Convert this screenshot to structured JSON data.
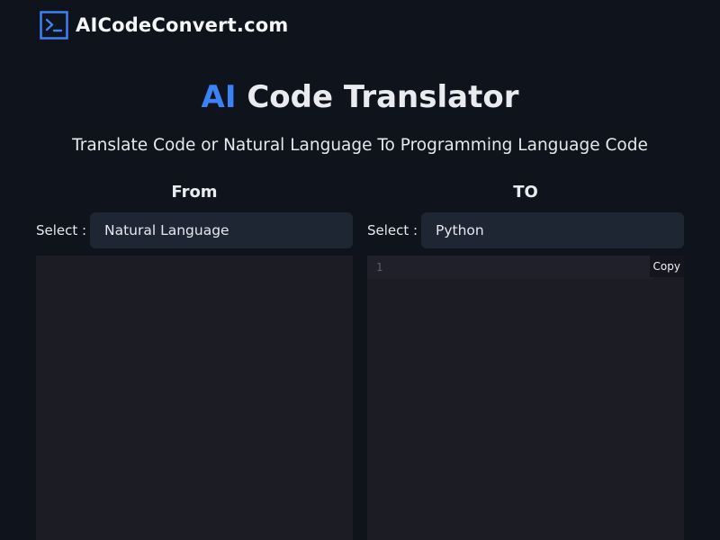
{
  "header": {
    "brand_text": "AICodeConvert.com",
    "logo_icon": "terminal-icon",
    "accent_color": "#3b82f6"
  },
  "hero": {
    "title_accent": "AI",
    "title_rest": " Code Translator",
    "subtitle": "Translate Code or Natural Language To Programming Language Code"
  },
  "from_panel": {
    "heading": "From",
    "select_label": "Select :",
    "selected_language": "Natural Language",
    "input_value": ""
  },
  "to_panel": {
    "heading": "TO",
    "select_label": "Select :",
    "selected_language": "Python",
    "line_number": "1",
    "copy_label": "Copy"
  }
}
